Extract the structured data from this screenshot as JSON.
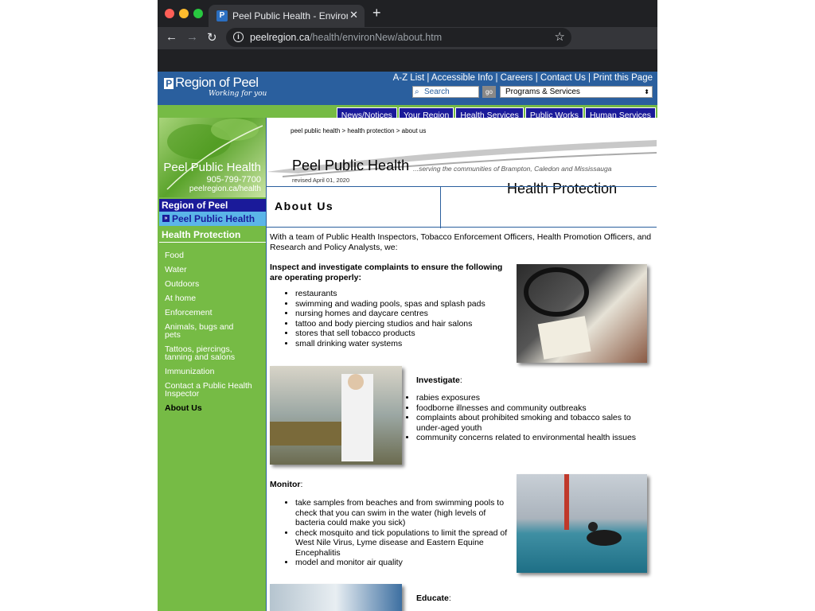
{
  "browser": {
    "tab_title": "Peel Public Health - Environme",
    "url_host": "peelregion.ca",
    "url_path": "/health/environNew/about.htm"
  },
  "header": {
    "logo_name": "Region of Peel",
    "logo_tag": "Working for you",
    "top_links": "A-Z List | Accessible Info | Careers | Contact Us | Print this Page",
    "search_placeholder": "Search",
    "go_label": "go",
    "dropdown_value": "Programs & Services"
  },
  "nav_tabs": [
    "News/Notices",
    "Your Region",
    "Health Services",
    "Public Works",
    "Human Services"
  ],
  "left": {
    "photo_title": "Peel Public Health",
    "phone": "905-799-7700",
    "web": "peelregion.ca/health",
    "region_label": "Region of Peel",
    "pph_label": "Peel Public Health",
    "section_label": "Health Protection",
    "nav_items": [
      "Food",
      "Water",
      "Outdoors",
      "At home",
      "Enforcement",
      "Animals, bugs and pets",
      "Tattoos, piercings, tanning and salons",
      "Immunization",
      "Contact a Public Health Inspector",
      "About Us"
    ]
  },
  "banner": {
    "breadcrumb": "peel public health > health protection > about us",
    "title": "Peel Public Health",
    "subtitle": "...serving the communities of Brampton, Caledon and Mississauga",
    "revised": "revised April 01, 2020",
    "section": "Health Protection"
  },
  "main": {
    "heading": "About Us",
    "intro": "With a team of Public Health Inspectors, Tobacco Enforcement Officers, Health Promotion Officers, and Research and Policy Analysts, we:",
    "inspect_heading": "Inspect and investigate complaints to ensure the following are operating properly:",
    "inspect_items": [
      "restaurants",
      "swimming and wading pools, spas and splash pads",
      "nursing homes and daycare centres",
      "tattoo and body piercing studios and hair salons",
      "stores that sell tobacco products",
      "small drinking water systems"
    ],
    "investigate_heading": "Investigate",
    "investigate_items": [
      "rabies exposures",
      "foodborne illnesses and community outbreaks",
      "complaints about prohibited smoking and tobacco sales to under-aged youth",
      "community concerns related to environmental health issues"
    ],
    "monitor_heading": "Monitor",
    "monitor_items": [
      "take samples from beaches and from swimming pools to check that you can swim in the water (high levels of bacteria could make you sick)",
      "check mosquito and tick populations to limit the spread of West Nile Virus, Lyme disease and Eastern Equine Encephalitis",
      "model and monitor air quality"
    ],
    "educate_heading": "Educate"
  }
}
